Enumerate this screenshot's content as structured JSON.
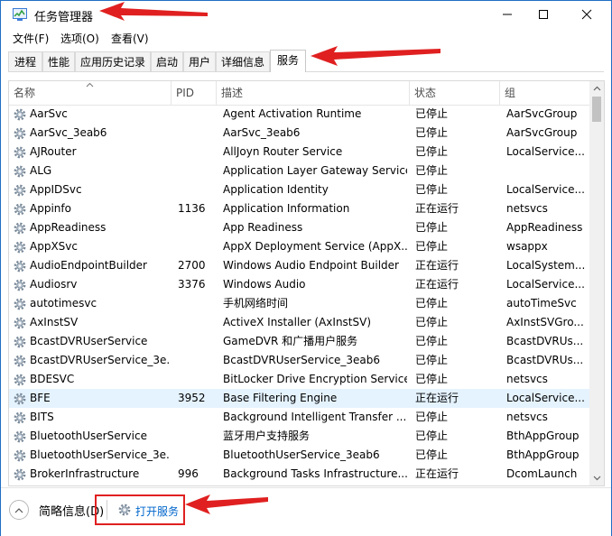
{
  "window": {
    "title": "任务管理器",
    "controls": {
      "minimize": "—",
      "maximize": "☐",
      "close": "✕"
    }
  },
  "menu": [
    "文件(F)",
    "选项(O)",
    "查看(V)"
  ],
  "tabs": [
    "进程",
    "性能",
    "应用历史记录",
    "启动",
    "用户",
    "详细信息",
    "服务"
  ],
  "active_tab": "服务",
  "columns": [
    "名称",
    "PID",
    "描述",
    "状态",
    "组"
  ],
  "services": [
    {
      "name": "AarSvc",
      "pid": "",
      "desc": "Agent Activation Runtime",
      "status": "已停止",
      "group": "AarSvcGroup"
    },
    {
      "name": "AarSvc_3eab6",
      "pid": "",
      "desc": "AarSvc_3eab6",
      "status": "已停止",
      "group": "AarSvcGroup"
    },
    {
      "name": "AJRouter",
      "pid": "",
      "desc": "AllJoyn Router Service",
      "status": "已停止",
      "group": "LocalService..."
    },
    {
      "name": "ALG",
      "pid": "",
      "desc": "Application Layer Gateway Service",
      "status": "已停止",
      "group": ""
    },
    {
      "name": "AppIDSvc",
      "pid": "",
      "desc": "Application Identity",
      "status": "已停止",
      "group": "LocalService..."
    },
    {
      "name": "Appinfo",
      "pid": "1136",
      "desc": "Application Information",
      "status": "正在运行",
      "group": "netsvcs"
    },
    {
      "name": "AppReadiness",
      "pid": "",
      "desc": "App Readiness",
      "status": "已停止",
      "group": "AppReadiness"
    },
    {
      "name": "AppXSvc",
      "pid": "",
      "desc": "AppX Deployment Service (AppX...",
      "status": "已停止",
      "group": "wsappx"
    },
    {
      "name": "AudioEndpointBuilder",
      "pid": "2700",
      "desc": "Windows Audio Endpoint Builder",
      "status": "正在运行",
      "group": "LocalSystem..."
    },
    {
      "name": "Audiosrv",
      "pid": "3376",
      "desc": "Windows Audio",
      "status": "正在运行",
      "group": "LocalService..."
    },
    {
      "name": "autotimesvc",
      "pid": "",
      "desc": "手机网络时间",
      "status": "已停止",
      "group": "autoTimeSvc"
    },
    {
      "name": "AxInstSV",
      "pid": "",
      "desc": "ActiveX Installer (AxInstSV)",
      "status": "已停止",
      "group": "AxInstSVGro..."
    },
    {
      "name": "BcastDVRUserService",
      "pid": "",
      "desc": "GameDVR 和广播用户服务",
      "status": "已停止",
      "group": "BcastDVRUs..."
    },
    {
      "name": "BcastDVRUserService_3e...",
      "pid": "",
      "desc": "BcastDVRUserService_3eab6",
      "status": "已停止",
      "group": "BcastDVRUs..."
    },
    {
      "name": "BDESVC",
      "pid": "",
      "desc": "BitLocker Drive Encryption Service",
      "status": "已停止",
      "group": "netsvcs"
    },
    {
      "name": "BFE",
      "pid": "3952",
      "desc": "Base Filtering Engine",
      "status": "正在运行",
      "group": "LocalService..."
    },
    {
      "name": "BITS",
      "pid": "",
      "desc": "Background Intelligent Transfer ...",
      "status": "已停止",
      "group": "netsvcs"
    },
    {
      "name": "BluetoothUserService",
      "pid": "",
      "desc": "蓝牙用户支持服务",
      "status": "已停止",
      "group": "BthAppGroup"
    },
    {
      "name": "BluetoothUserService_3e...",
      "pid": "",
      "desc": "BluetoothUserService_3eab6",
      "status": "已停止",
      "group": "BthAppGroup"
    },
    {
      "name": "BrokerInfrastructure",
      "pid": "996",
      "desc": "Background Tasks Infrastructure...",
      "status": "正在运行",
      "group": "DcomLaunch"
    }
  ],
  "selected_service": "BFE",
  "footer": {
    "brief": "简略信息(D)",
    "open_services": "打开服务"
  },
  "colors": {
    "selected_row": "#e5f3ff",
    "annotation": "#e02020",
    "link": "#0066cc"
  }
}
